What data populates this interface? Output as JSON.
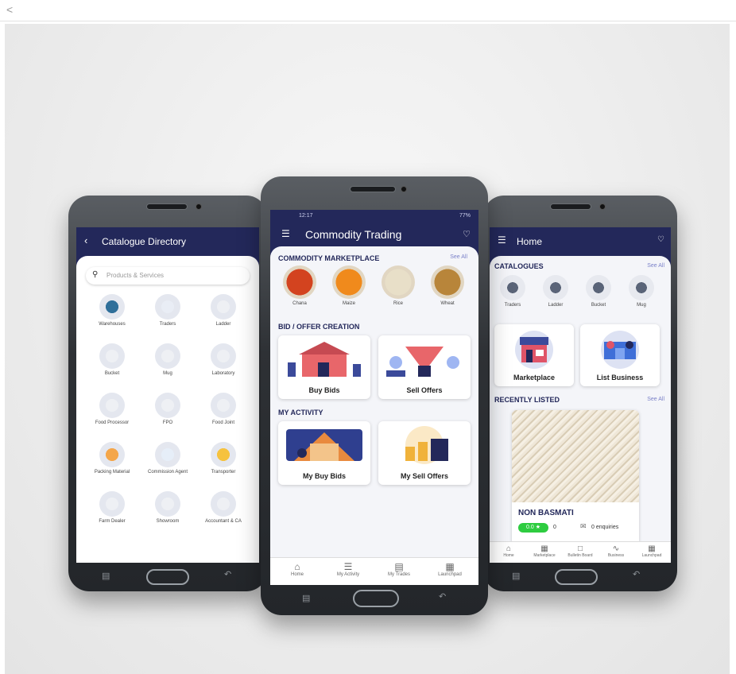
{
  "colors": {
    "header": "#23285a",
    "accent_green": "#2ecc40"
  },
  "page": {
    "share_icon": "share-icon"
  },
  "left": {
    "status": "",
    "title": "Catalogue Directory",
    "search_placeholder": "Products & Services",
    "items": [
      {
        "label": "Warehouses"
      },
      {
        "label": "Traders"
      },
      {
        "label": "Ladder"
      },
      {
        "label": "Bucket"
      },
      {
        "label": "Mug"
      },
      {
        "label": "Laboratory"
      },
      {
        "label": "Food Processor"
      },
      {
        "label": "FPO"
      },
      {
        "label": "Food Joint"
      },
      {
        "label": "Packing Material"
      },
      {
        "label": "Commission Agent"
      },
      {
        "label": "Transporter"
      },
      {
        "label": "Farm Dealer"
      },
      {
        "label": "Showroom"
      },
      {
        "label": "Accountant & CA"
      }
    ]
  },
  "middle": {
    "status_time": "12:17",
    "status_right": "77%",
    "title": "Commodity Trading",
    "marketplace": {
      "heading": "COMMODITY MARKETPLACE",
      "see_all": "See All",
      "items": [
        {
          "label": "Chana"
        },
        {
          "label": "Maize"
        },
        {
          "label": "Rice"
        },
        {
          "label": "Wheat"
        }
      ]
    },
    "bid": {
      "heading": "BID / OFFER CREATION",
      "buy": "Buy Bids",
      "sell": "Sell Offers"
    },
    "activity": {
      "heading": "MY ACTIVITY",
      "buy": "My Buy Bids",
      "sell": "My Sell Offers"
    },
    "nav": [
      {
        "label": "Home"
      },
      {
        "label": "My Activity"
      },
      {
        "label": "My Trades"
      },
      {
        "label": "Launchpad"
      }
    ]
  },
  "right": {
    "title": "Home",
    "catalogues": {
      "heading": "CATALOGUES",
      "see_all": "See All",
      "items": [
        {
          "label": "Traders"
        },
        {
          "label": "Ladder"
        },
        {
          "label": "Bucket"
        },
        {
          "label": "Mug"
        }
      ]
    },
    "market": "Marketplace",
    "list_business": "List Business",
    "recent": {
      "heading": "RECENTLY LISTED",
      "see_all": "See All"
    },
    "product": {
      "name": "NON BASMATI",
      "rating": "0.0",
      "ratings_count": "0",
      "enquiries": "0 enquiries"
    },
    "nav": [
      {
        "label": "Home"
      },
      {
        "label": "Marketplace"
      },
      {
        "label": "Bulletin Board"
      },
      {
        "label": "Business"
      },
      {
        "label": "Launchpad"
      }
    ]
  }
}
